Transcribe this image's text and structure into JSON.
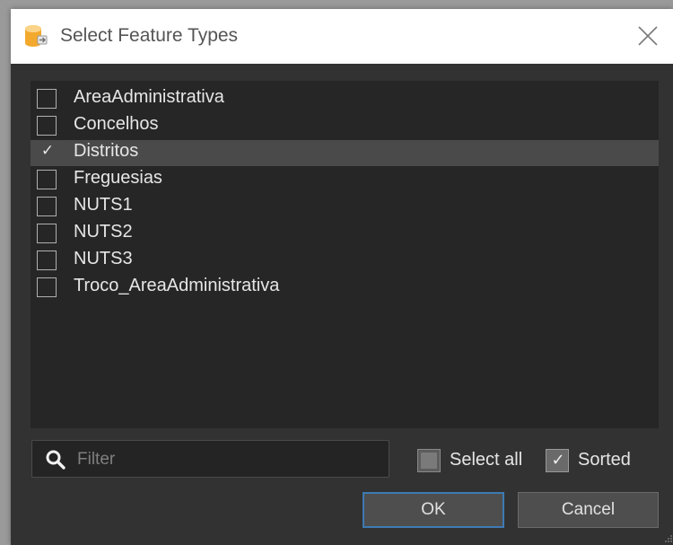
{
  "window": {
    "title": "Select Feature Types",
    "app_icon": "database-icon",
    "close_icon": "close-icon"
  },
  "feature_types": [
    {
      "label": "AreaAdministrativa",
      "checked": false,
      "selected": false
    },
    {
      "label": "Concelhos",
      "checked": false,
      "selected": false
    },
    {
      "label": "Distritos",
      "checked": true,
      "selected": true
    },
    {
      "label": "Freguesias",
      "checked": false,
      "selected": false
    },
    {
      "label": "NUTS1",
      "checked": false,
      "selected": false
    },
    {
      "label": "NUTS2",
      "checked": false,
      "selected": false
    },
    {
      "label": "NUTS3",
      "checked": false,
      "selected": false
    },
    {
      "label": "Troco_AreaAdministrativa",
      "checked": false,
      "selected": false
    }
  ],
  "filter": {
    "placeholder": "Filter",
    "value": "",
    "icon": "search-icon"
  },
  "options": {
    "select_all": {
      "label": "Select all",
      "checked": false
    },
    "sorted": {
      "label": "Sorted",
      "checked": true
    }
  },
  "buttons": {
    "ok": "OK",
    "cancel": "Cancel"
  },
  "colors": {
    "dialog_bg": "#323232",
    "list_bg": "#262626",
    "selected_row": "#4a4a4a",
    "default_button_border": "#3d7ab3"
  }
}
